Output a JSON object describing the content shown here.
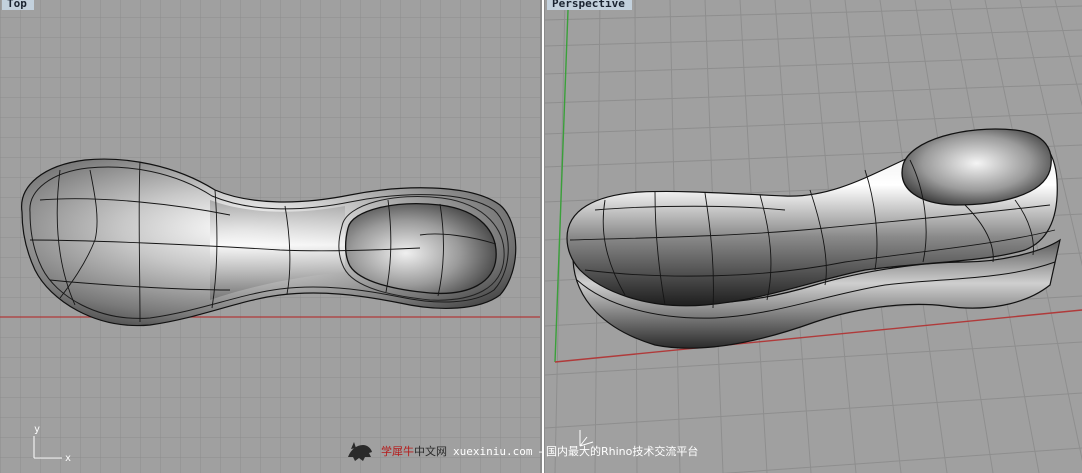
{
  "viewports": {
    "top": {
      "title": "Top",
      "axis_x": "x",
      "axis_y": "y"
    },
    "perspective": {
      "title": "Perspective"
    }
  },
  "watermark": {
    "brand_red": "学犀牛",
    "brand_rest": "中文网",
    "url": "xuexiniu.com",
    "slogan": "- 国内最大的Rhino技术交流平台"
  },
  "colors": {
    "background": "#a0a0a0",
    "grid": "#8c8c8c",
    "x_axis": "#b03a3a",
    "y_axis": "#3aa03a",
    "title_bg": "#c3d1dd"
  }
}
